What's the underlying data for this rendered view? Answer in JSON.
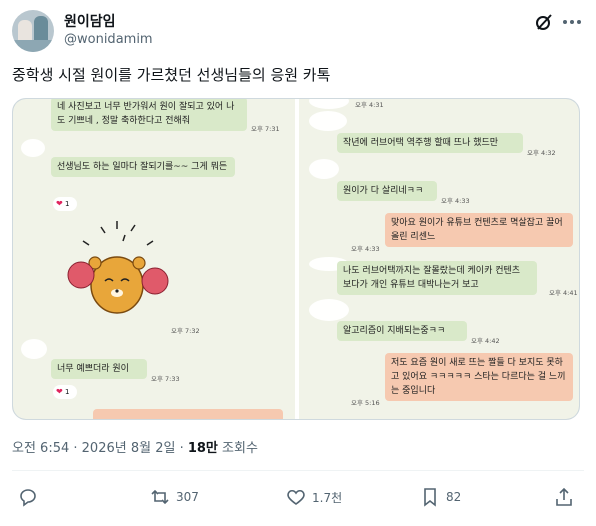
{
  "author": {
    "name": "원이담임",
    "handle": "@wonidamim"
  },
  "tweet": {
    "text": "중학생 시절 원이를 가르쳤던 선생님들의 응원 카톡",
    "time": "오전 6:54",
    "date": "2026년 8월 2일",
    "views_count": "18만",
    "views_label": "조회수"
  },
  "icons": {
    "grok": "grok-icon",
    "more": "more-horizontal-icon",
    "reply": "reply-icon",
    "retweet": "retweet-icon",
    "like": "heart-icon",
    "bookmark": "bookmark-icon",
    "share": "share-icon"
  },
  "actions": {
    "replies": "",
    "retweets": "307",
    "likes": "1.7천",
    "bookmarks": "82"
  },
  "chat_left": {
    "msg1": "네 사진보고 너무 반가워서 원이 잘되고 있어 나도 기쁘네 , 정말 축하한다고 전해줘",
    "time1": "오후 7:31",
    "msg2": "선생님도 하는 일마다  잘되기를~~  그게 뭐든",
    "reaction1_count": "1",
    "sticker_time": "오후 7:32",
    "msg3": "너무 예쁘더라 원이",
    "time3": "오후 7:33",
    "reaction2_count": "1"
  },
  "chat_right": {
    "top_time": "오후 4:31",
    "msg1": "작년에 러브어택 역주행 할때 뜨나 했드만",
    "time1": "오후 4:32",
    "msg2": "원이가 다 살리네ㅋㅋ",
    "time2": "오후 4:33",
    "msg3": "맞아요 원이가 유튜브 컨텐츠로 멱살잡고 끌어올린 리센느",
    "time3": "오후 4:33",
    "msg4": "나도 러브어택까지는 잘몰랐는데 케이카 컨텐츠 보다가 개인 유튜브 대박나는거 보고",
    "time4": "오후 4:41",
    "msg5": "알고리즘이 지배되는중ㅋㅋ",
    "time5": "오후 4:42",
    "msg6": "저도 요즘 원이 새로 뜨는 짤들 다 보지도 못하고 있어요 ㅋㅋㅋㅋㅋ 스타는 다르다는 걸 느끼는 중입니다",
    "time6": "오후 5:16"
  },
  "colors": {
    "my_bubble": "#f6c9b0",
    "friend_bubble": "#d9e9c9",
    "chat_bg": "#f1f3e8",
    "muted": "#536471"
  }
}
